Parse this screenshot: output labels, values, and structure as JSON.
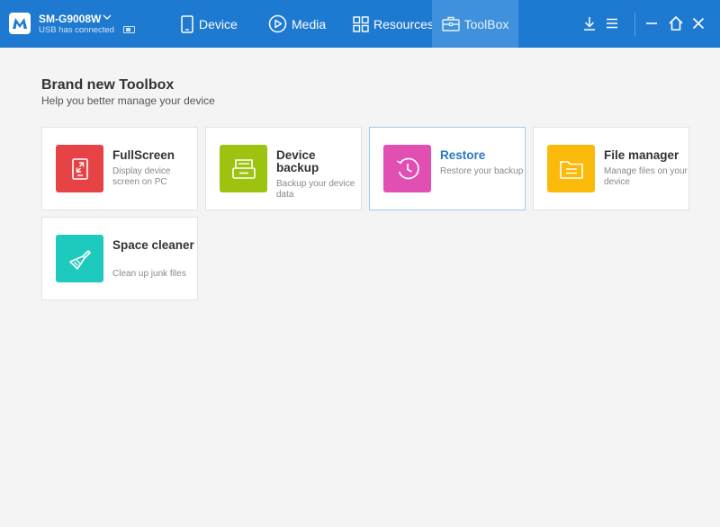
{
  "header": {
    "device_name": "SM-G9008W",
    "device_status": "USB has connected",
    "nav": [
      {
        "label": "Device",
        "icon": "phone-icon"
      },
      {
        "label": "Media",
        "icon": "play-circle-icon"
      },
      {
        "label": "Resources",
        "icon": "grid-icon"
      },
      {
        "label": "ToolBox",
        "icon": "toolbox-icon",
        "active": true
      }
    ],
    "accent_color": "#1e7ad1"
  },
  "main": {
    "title": "Brand new Toolbox",
    "subtitle": "Help you better manage your device",
    "tools": [
      {
        "title": "FullScreen",
        "desc": "Display device screen on PC",
        "color": "#e54346",
        "icon": "fullscreen-icon"
      },
      {
        "title": "Device backup",
        "desc": "Backup your device data",
        "color": "#9cc310",
        "icon": "drive-icon"
      },
      {
        "title": "Restore",
        "desc": "Restore your backup",
        "color": "#e14fb2",
        "icon": "clock-icon",
        "active": true
      },
      {
        "title": "File manager",
        "desc": "Manage files on your device",
        "color": "#fbb90a",
        "icon": "folder-icon"
      },
      {
        "title": "Space cleaner",
        "desc": "Clean up junk files",
        "color": "#1ec9bd",
        "icon": "brush-icon"
      }
    ]
  }
}
